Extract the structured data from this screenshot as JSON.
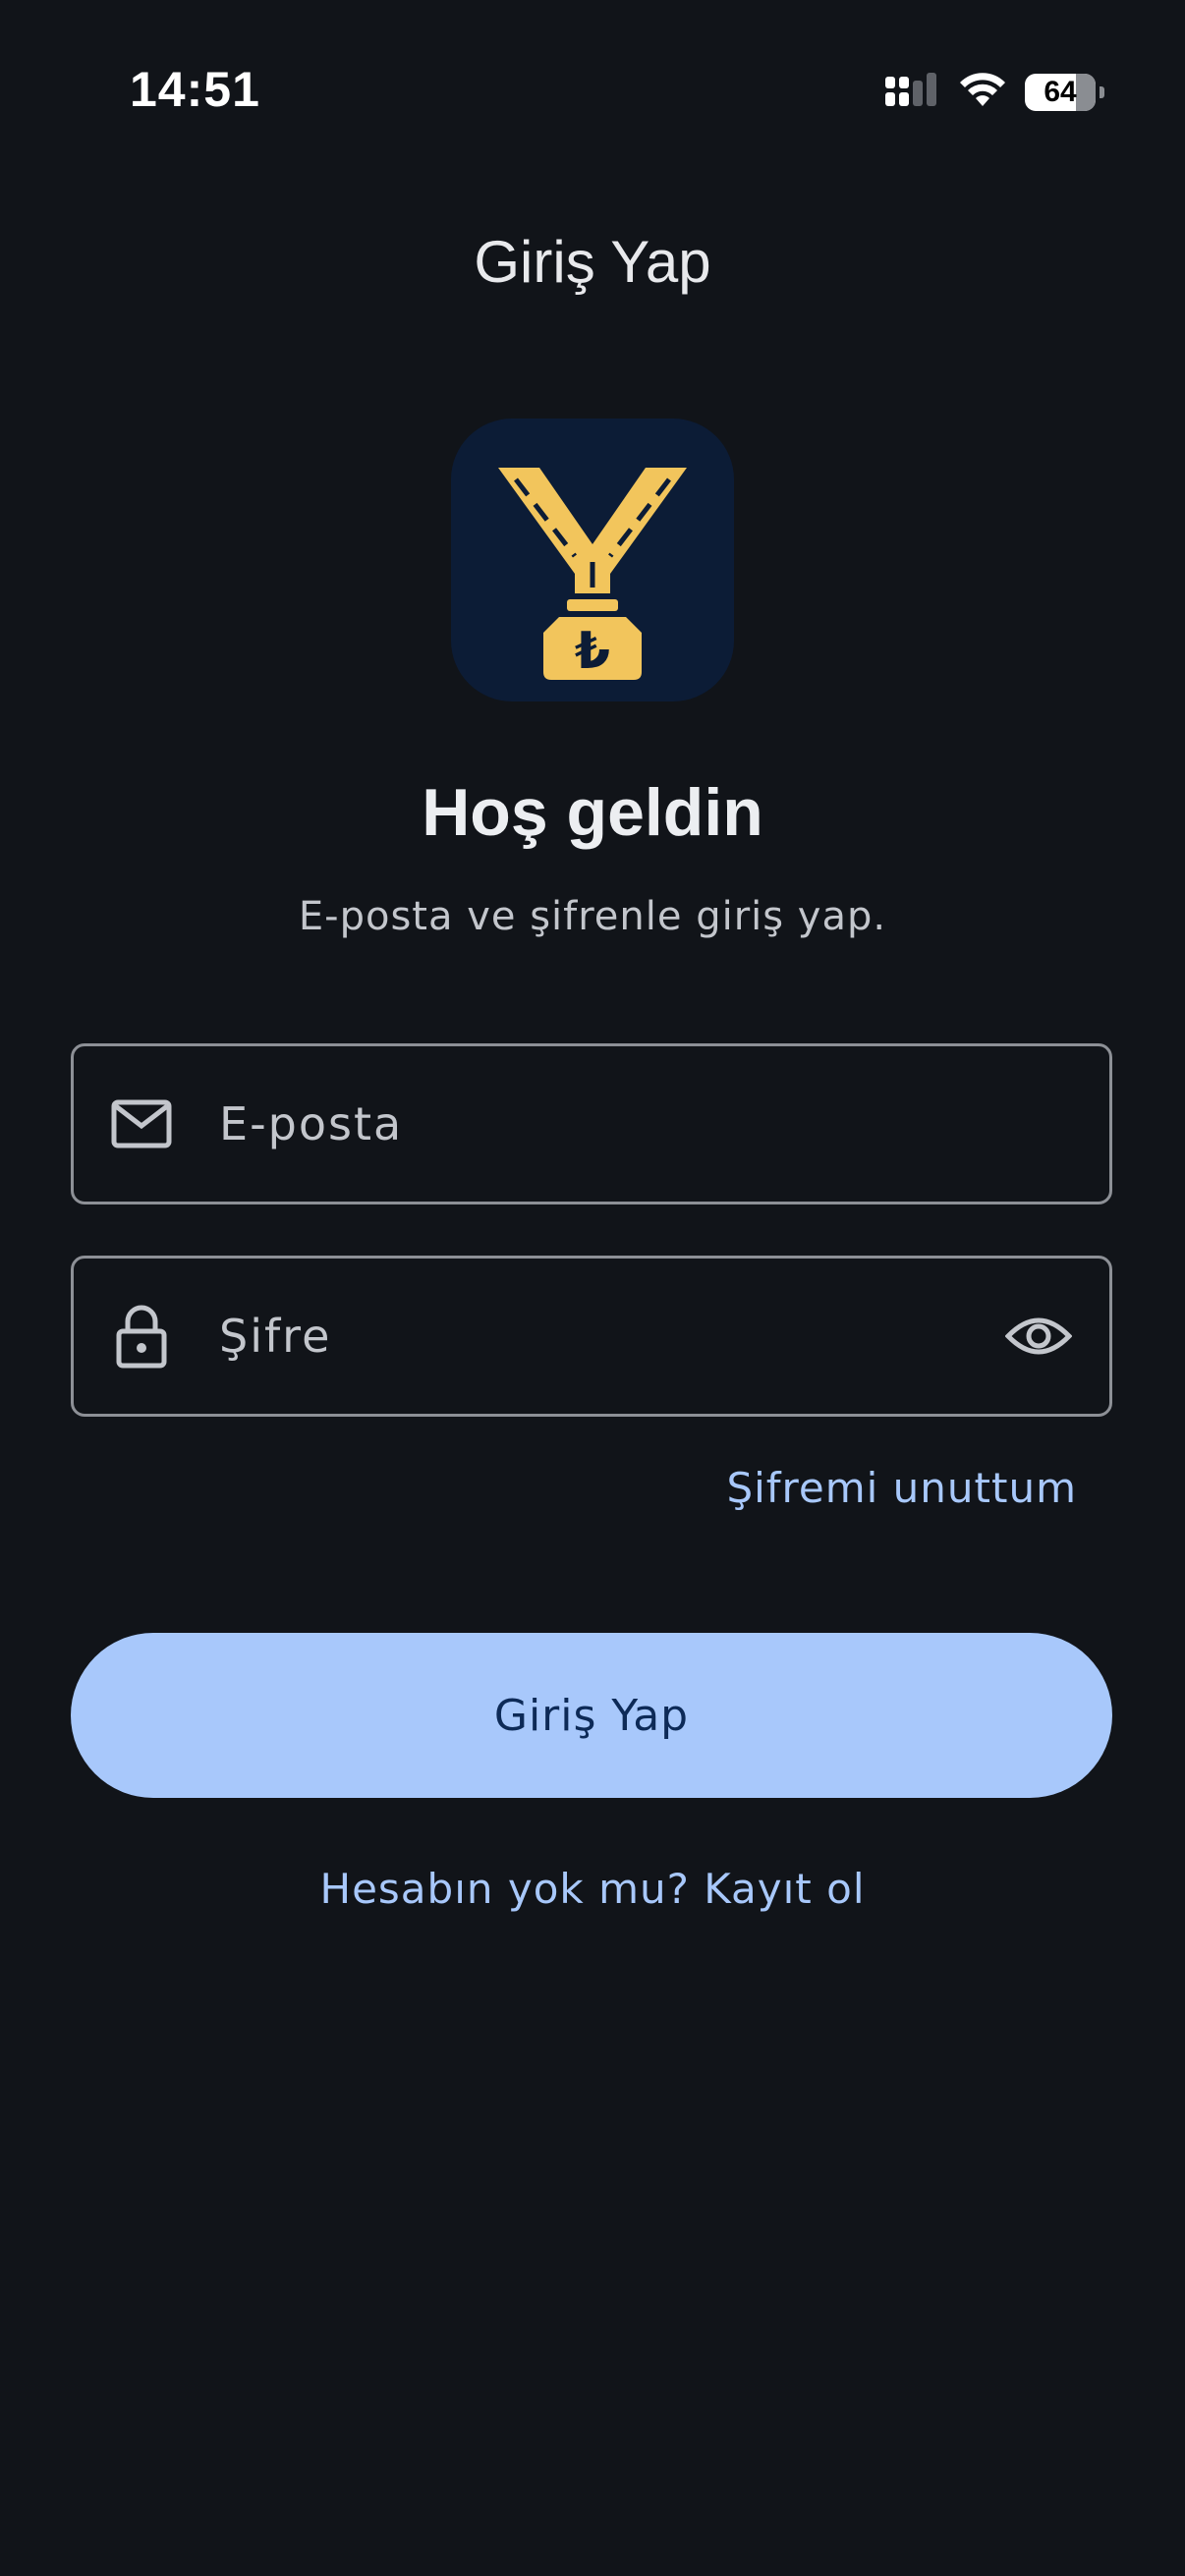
{
  "status_bar": {
    "time": "14:51",
    "battery_level": "64",
    "icons": [
      "cellular-signal-icon",
      "wifi-icon",
      "battery-icon"
    ]
  },
  "app_bar": {
    "title": "Giriş Yap"
  },
  "logo": {
    "icon": "medal-lira-icon",
    "background": "#0c1c36",
    "accent": "#f2c55c",
    "symbol": "₺"
  },
  "header": {
    "welcome": "Hoş geldin",
    "subtitle": "E-posta ve şifrenle giriş yap."
  },
  "form": {
    "email": {
      "placeholder": "E-posta",
      "value": "",
      "icon": "mail-icon"
    },
    "password": {
      "placeholder": "Şifre",
      "value": "",
      "icon": "lock-icon",
      "toggle_icon": "eye-icon"
    },
    "forgot_label": "Şifremi unuttum",
    "submit_label": "Giriş Yap",
    "register_label": "Hesabın yok mu? Kayıt ol"
  },
  "colors": {
    "background": "#111419",
    "primary": "#a8c8fb",
    "on_primary": "#0d2a57",
    "outline": "#8d9096"
  }
}
